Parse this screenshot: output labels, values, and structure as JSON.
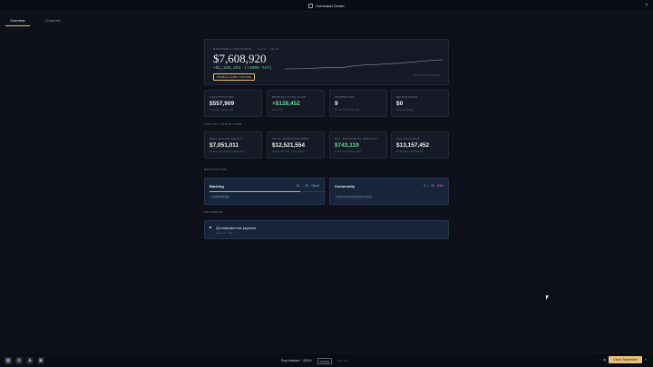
{
  "window": {
    "title": "Command Center",
    "close_glyph": "✕"
  },
  "tabs": [
    {
      "label": "Overview",
      "active": true
    },
    {
      "label": "Channels",
      "active": false
    }
  ],
  "hero": {
    "label": "HARTWELL HOLDINGS",
    "sub1": "· 5 areas",
    "sub2": "Sep 30",
    "networth": "$7,608,920",
    "change": "+$1,328,452",
    "change_pct": "(+100% YoY)",
    "status": "STABLE FAMILY OFFICE",
    "spark_caption": "12-MONTH NET WORTH",
    "spark_values": [
      0.35,
      0.36,
      0.37,
      0.4,
      0.42,
      0.43,
      0.45,
      0.55,
      0.6,
      0.63,
      0.66,
      0.7,
      0.74,
      0.8,
      0.86,
      0.9,
      0.95
    ]
  },
  "metrics": [
    {
      "label": "CASH POSITION",
      "value": "$557,909",
      "sub": "Checking · Savings · Est."
    },
    {
      "label": "MONTHLY CASH FLOW",
      "value": "+$128,452",
      "sub": "Last month",
      "green": true
    },
    {
      "label": "PROPERTIES",
      "value": "9",
      "sub": "$7,075,158 portfolio value"
    },
    {
      "label": "RECEIVABLES",
      "value": "$0",
      "sub": "None outstanding"
    }
  ],
  "capital_title": "CAPITAL STRUCTURE",
  "capital": [
    {
      "label": "REAL ESTATE EQUITY",
      "value": "$7,051,011",
      "sub": "Property value minus mortgage debt"
    },
    {
      "label": "TOTAL MORTGAGE DEBT",
      "value": "$12,521,554",
      "sub": "Portfolio LTV 64% · 9 loans active"
    },
    {
      "label": "EST. BORROWING CAPACITY",
      "value": "$743,119",
      "sub": "at 75% LTV across portfolio"
    },
    {
      "label": "LOC AVAILABLE",
      "value": "$13,157,452",
      "sub": "$2.3M drawn of $15.5M line"
    }
  ],
  "reputation_title": "REPUTATION",
  "reputation": [
    {
      "title": "Banking",
      "score": "61 → 78",
      "tag": "Good",
      "tag_class": "good",
      "fill": 0.78,
      "note": "+ 0.25% LOC rate",
      "note_class": ""
    },
    {
      "title": "Community",
      "score": "0 → 10",
      "tag": "Risk",
      "tag_class": "risk",
      "fill": 0.0,
      "note": "Attend 1 event this quarter to unlock",
      "note_class": "muted"
    }
  ],
  "upcoming_title": "UPCOMING",
  "upcoming": {
    "title": "Q4 estimated tax payment",
    "meta": "Due in Oct · $45k"
  },
  "taskbar": {
    "icons": [
      "grid-icon",
      "trash-icon",
      "users-icon",
      "calendar-icon"
    ],
    "icon_glyphs": [
      "▦",
      "▤",
      "♟",
      "▣"
    ],
    "date": "September 2034",
    "badge": "STABLE",
    "sub": "Day 30",
    "controls": [
      "‹",
      "◉"
    ],
    "primary": "Close September",
    "more": "▾"
  }
}
